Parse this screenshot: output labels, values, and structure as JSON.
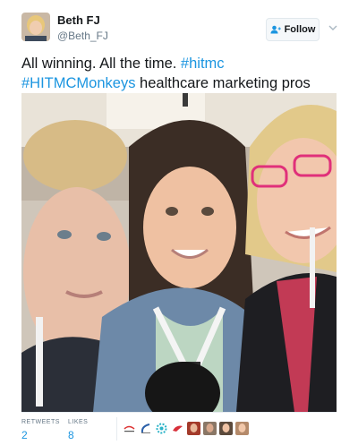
{
  "author": {
    "name": "Beth FJ",
    "handle": "@Beth_FJ"
  },
  "follow_button": {
    "label": "Follow",
    "icon": "add-user-icon"
  },
  "menu_icon": "chevron-down-icon",
  "tweet": {
    "text_plain_1": "All winning. All the time. ",
    "hashtag_1": "#hitmc",
    "hashtag_2": "#HITMCMonkeys",
    "text_plain_2": " healthcare marketing pros"
  },
  "stats": {
    "retweets_label": "RETWEETS",
    "retweets_count": "2",
    "likes_label": "LIKES",
    "likes_count": "8"
  },
  "colors": {
    "link": "#1b95e0",
    "text": "#14171a",
    "muted": "#657786"
  }
}
